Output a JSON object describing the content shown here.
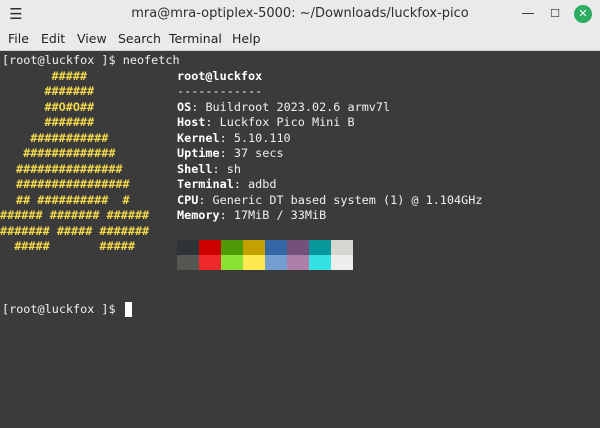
{
  "window": {
    "title": "mra@mra-optiplex-5000: ~/Downloads/luckfox-pico"
  },
  "menubar": {
    "items": [
      "File",
      "Edit",
      "View",
      "Search",
      "Terminal",
      "Help"
    ]
  },
  "terminal": {
    "prompt": "[root@luckfox ]$ ",
    "command": "neofetch",
    "user_host": "root@luckfox",
    "separator": "------------",
    "info": [
      {
        "key": "OS",
        "value": "Buildroot 2023.02.6 armv7l"
      },
      {
        "key": "Host",
        "value": "Luckfox Pico Mini B"
      },
      {
        "key": "Kernel",
        "value": "5.10.110"
      },
      {
        "key": "Uptime",
        "value": "37 secs"
      },
      {
        "key": "Shell",
        "value": "sh"
      },
      {
        "key": "Terminal",
        "value": "adbd"
      },
      {
        "key": "CPU",
        "value": "Generic DT based system (1) @ 1.104GHz"
      },
      {
        "key": "Memory",
        "value": "17MiB / 33MiB"
      }
    ],
    "logo": [
      "     #####",
      "    #######",
      "    ##O#O##",
      "    #######",
      "  ###########",
      " #############",
      "###############",
      "################",
      "## ##########  #",
      "###### ####### ######",
      "####### ##### #######",
      "  #####       #####"
    ],
    "palette_top": [
      "#2e3436",
      "#cc0000",
      "#4e9a06",
      "#c4a000",
      "#3465a4",
      "#75507b",
      "#06989a",
      "#d3d7cf"
    ],
    "palette_bottom": [
      "#555753",
      "#ef2929",
      "#8ae234",
      "#fce94f",
      "#729fcf",
      "#ad7fa8",
      "#34e2e2",
      "#eeeeec"
    ],
    "final_prompt": "[root@luckfox ]$ "
  }
}
